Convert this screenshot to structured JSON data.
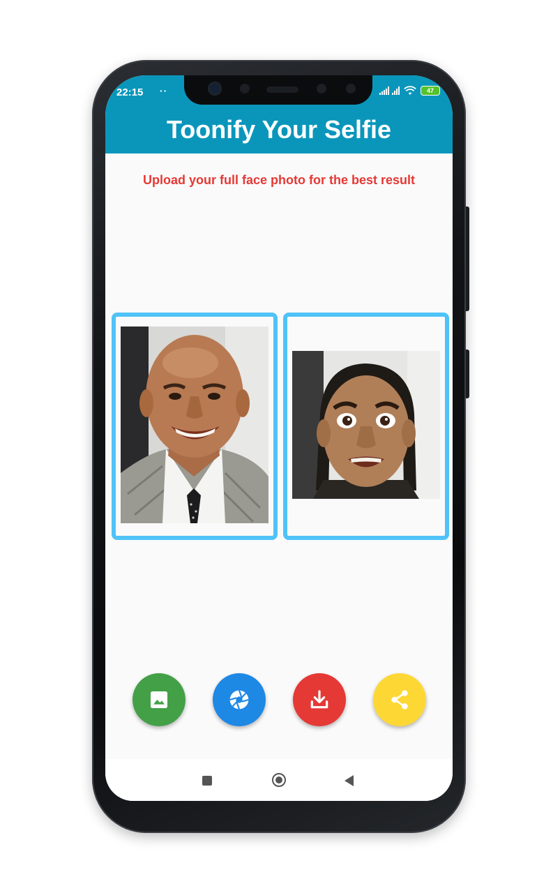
{
  "status_bar": {
    "time": "22:15",
    "notification_dots": "··",
    "battery_level": "47"
  },
  "app_bar": {
    "title": "Toonify Your Selfie",
    "color": "#0a96bb"
  },
  "main": {
    "hint_text": "Upload your full face photo for the best result",
    "hint_color": "#e53935",
    "frame_color": "#4fc3f7",
    "input_image_icon": "portrait-photo",
    "output_image_icon": "cartoon-portrait"
  },
  "actions": [
    {
      "name": "gallery",
      "icon": "image-icon",
      "color": "#43a047"
    },
    {
      "name": "camera",
      "icon": "camera-shutter-icon",
      "color": "#1e88e5"
    },
    {
      "name": "download",
      "icon": "download-icon",
      "color": "#e53935"
    },
    {
      "name": "share",
      "icon": "share-icon",
      "color": "#fdd835"
    }
  ],
  "nav_bar": {
    "icons": [
      "recents-square-icon",
      "home-circle-icon",
      "back-triangle-icon"
    ]
  }
}
